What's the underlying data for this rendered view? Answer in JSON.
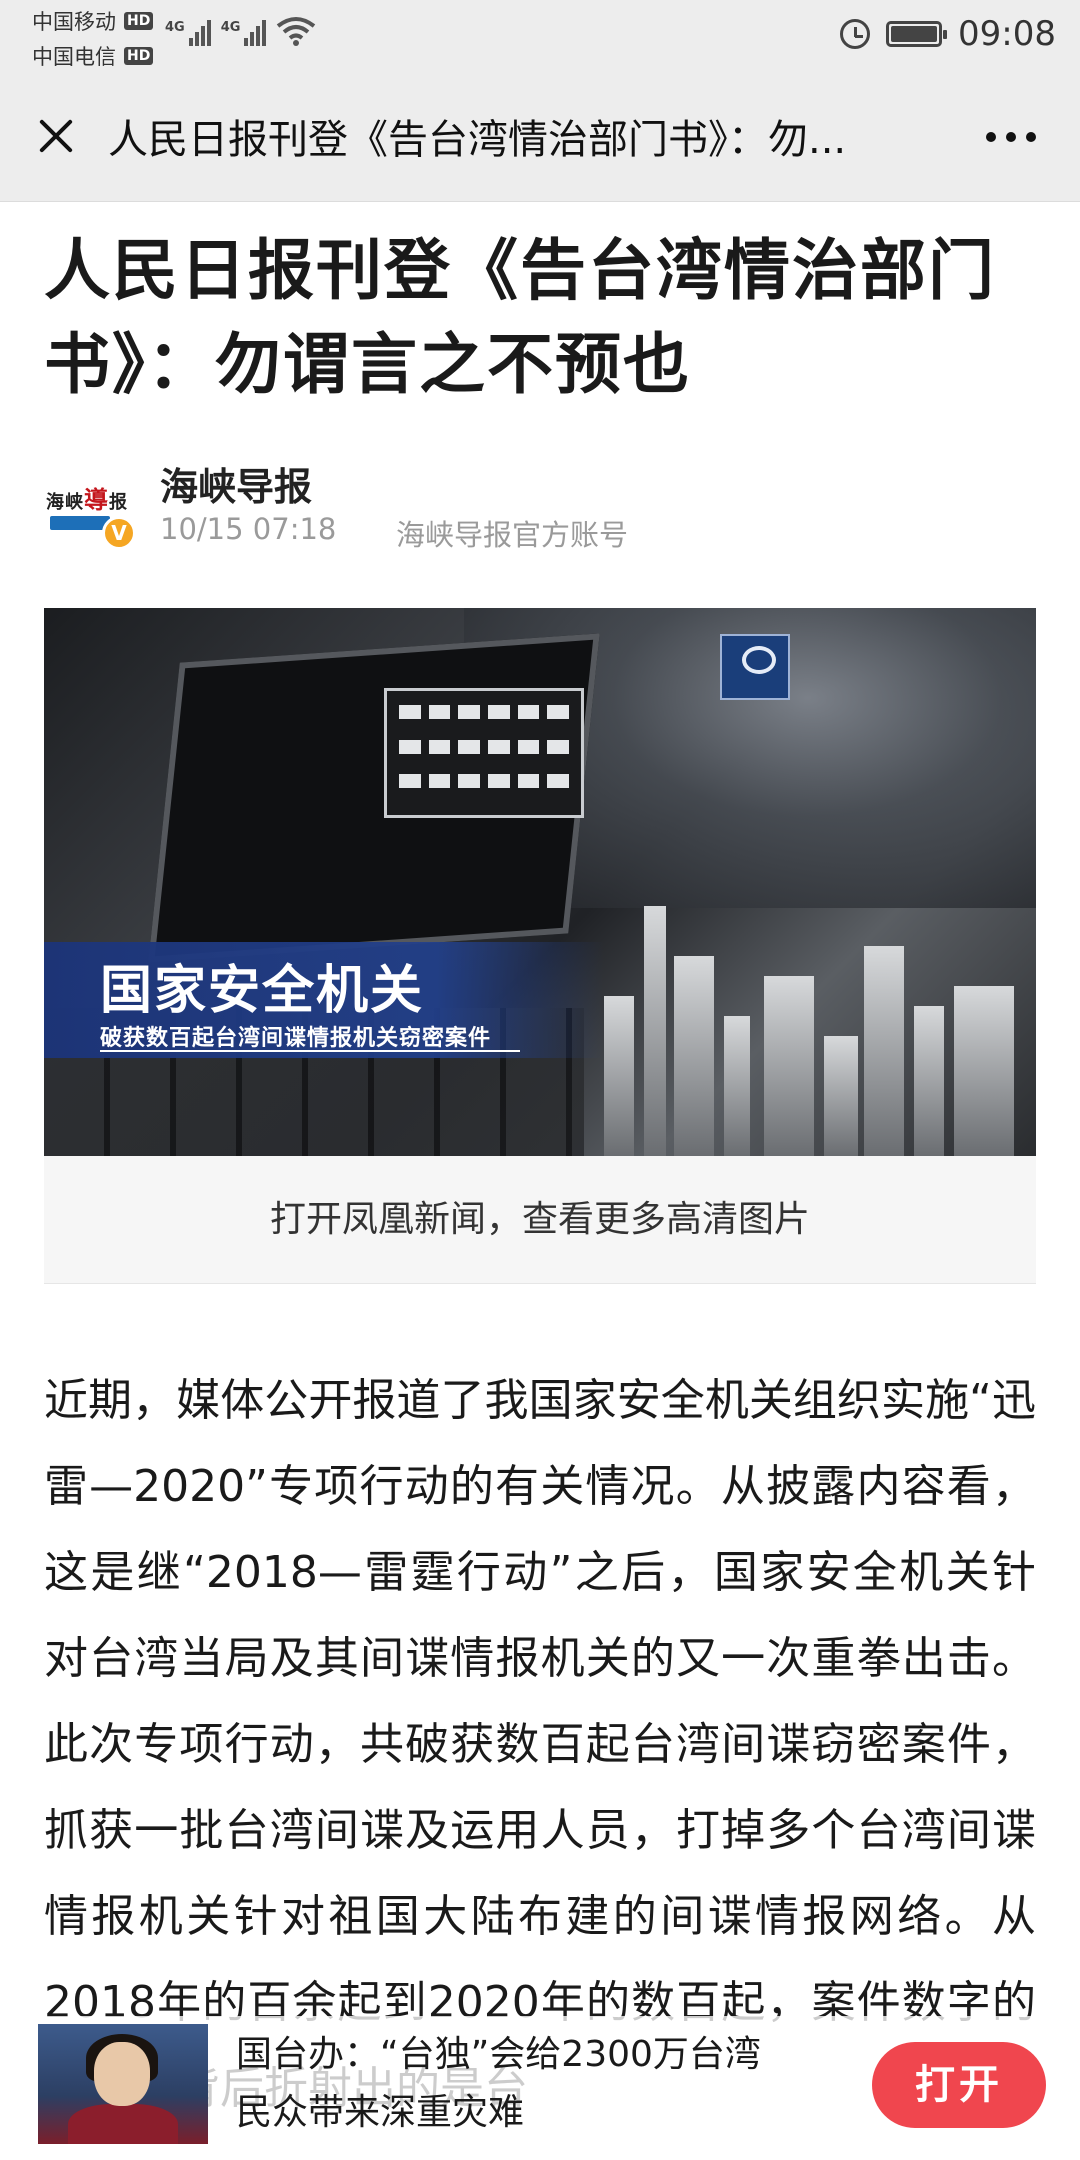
{
  "status_bar": {
    "carrier_1": "中国移动",
    "carrier_2": "中国电信",
    "hd_badge": "HD",
    "network_1": "4G",
    "network_2": "4G",
    "time": "09:08"
  },
  "nav": {
    "title": "人民日报刊登《告台湾情治部门书》：勿..."
  },
  "article": {
    "title": "人民日报刊登《告台湾情治部门书》：勿谓言之不预也",
    "author": {
      "name": "海峡导报",
      "date": "10/15 07:18",
      "account_desc": "海峡导报官方账号",
      "logo_text_1": "海峡",
      "logo_text_red": "導",
      "logo_text_2": "报"
    },
    "hero": {
      "headline": "国家安全机关",
      "subheadline": "破获数百起台湾间谍情报机关窃密案件"
    },
    "open_images_label": "打开凤凰新闻，查看更多高清图片",
    "body": "近期，媒体公开报道了我国家安全机关组织实施“迅雷—2020”专项行动的有关情况。从披露内容看，这是继“2018—雷霆行动”之后，国家安全机关针对台湾当局及其间谍情报机关的又一次重拳出击。此次专项行动，共破获数百起台湾间谍窃密案件，抓获一批台湾间谍及运用人员，打掉多个台湾间谍情报机关针对祖国大陆布建的间谍情报网络。从2018年的百余起到2020年的数百起，案件数字的翻番，背后折射出的是台"
  },
  "promo": {
    "text": "国台办：“台独”会给2300万台湾民众带来深重灾难",
    "open_label": "打开"
  }
}
